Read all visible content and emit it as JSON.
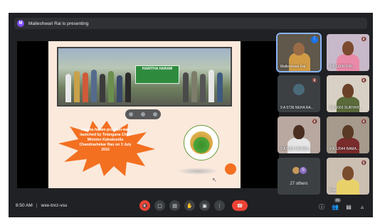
{
  "header": {
    "presenter_initial": "M",
    "presenter_text": "Malleshwari Rai is presenting"
  },
  "slide": {
    "banner_text": "HARITHA HARAM",
    "burst_text": "Haritha haram program was launched by Telangana Chief Minister Kalvakuntla Chandrashekar Rao on 3 July 2015"
  },
  "participants": {
    "tiles": [
      {
        "name": "Malleshwari Rai",
        "active": true
      },
      {
        "name": "9 A 11030 KRI..."
      },
      {
        "name": "9 A 5736 NEHA RA..."
      },
      {
        "name": "9 A 5003 SURYAH..."
      },
      {
        "name": "9 A 5660 MOKSH..."
      },
      {
        "name": "9 A 12044 BAMA..."
      },
      {
        "name": "You"
      }
    ],
    "others_initial": "S",
    "others_label": "27 others"
  },
  "bottom": {
    "time": "8:50 AM",
    "separator": "|",
    "meeting_code": "wxe-tnrz-vsu",
    "people_count": "31"
  },
  "colors": {
    "background": "#202124",
    "tile": "#3c4043",
    "accent_red": "#ea4335",
    "accent_blue": "#8ab4f8",
    "slide_bg": "#fbe9dc",
    "burst_orange": "#f37021"
  },
  "icons": [
    "mic-off-icon",
    "camera-icon",
    "captions-icon",
    "raise-hand-icon",
    "present-icon",
    "more-options-icon",
    "end-call-icon",
    "info-icon",
    "people-icon",
    "chat-icon",
    "activities-icon"
  ]
}
